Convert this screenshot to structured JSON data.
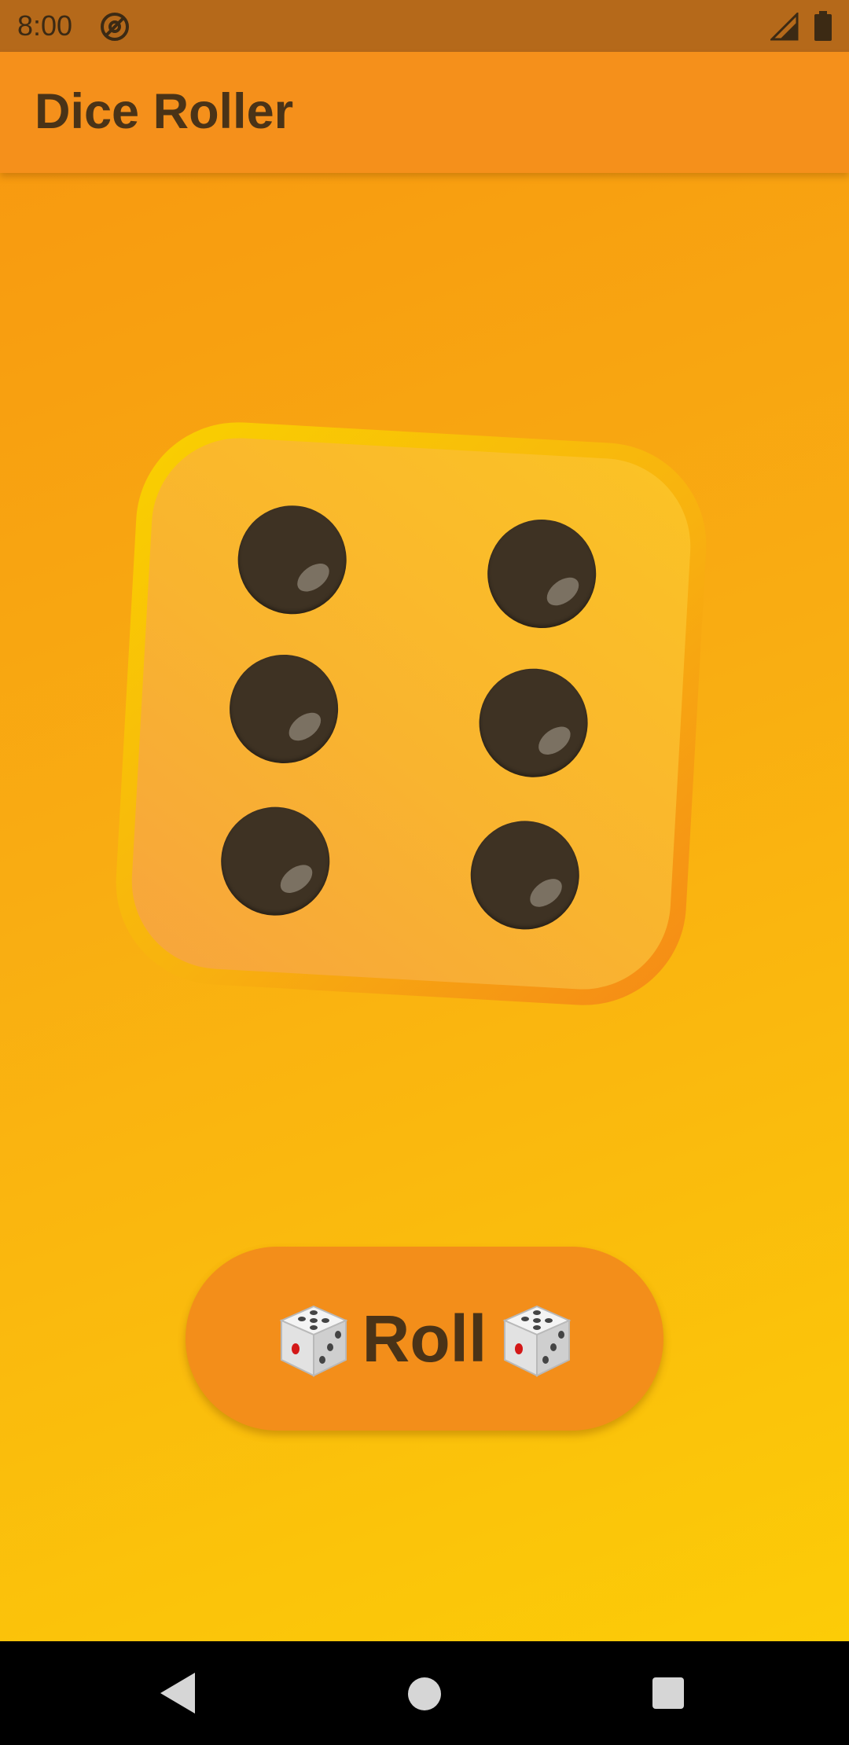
{
  "status_bar": {
    "time": "8:00",
    "icons": [
      "at-sign-icon",
      "signal-icon",
      "battery-icon"
    ]
  },
  "app_bar": {
    "title": "Dice Roller"
  },
  "die": {
    "value": 6,
    "face_icon": "dice-six-face-icon"
  },
  "roll_button": {
    "label": "Roll",
    "icon": "dice-emoji-icon"
  },
  "nav_bar": {
    "buttons": [
      "back-icon",
      "home-icon",
      "recents-icon"
    ]
  },
  "colors": {
    "app_bar": "#f5901b",
    "status_bar": "#b5691a",
    "button": "#f38e1a",
    "text": "#4a3317",
    "pip": "#3e3223"
  }
}
